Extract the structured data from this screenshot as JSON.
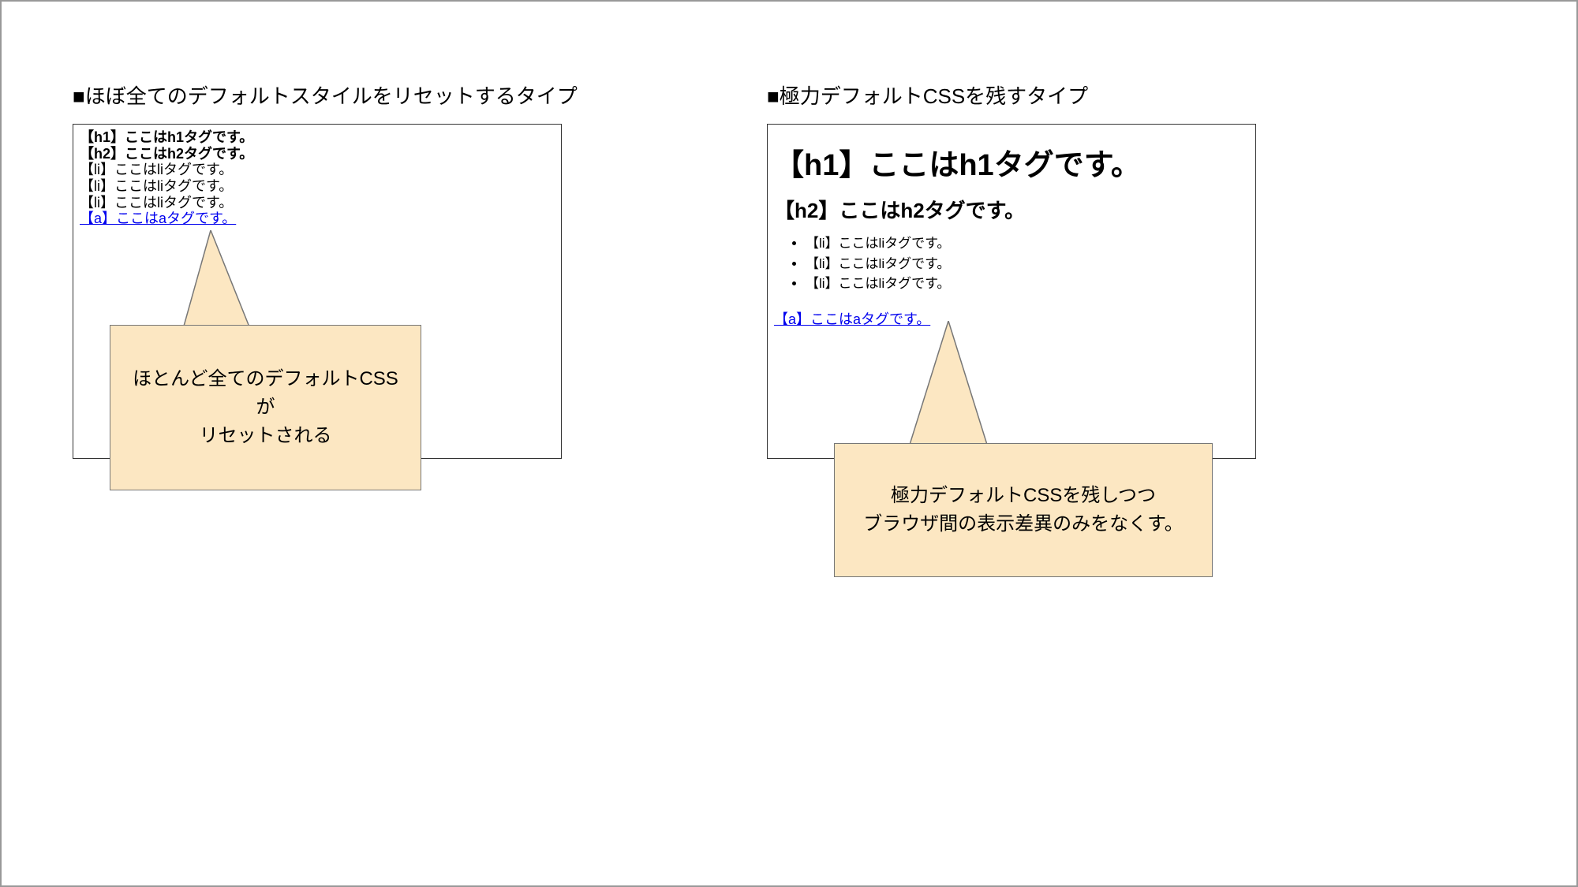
{
  "left": {
    "title": "■ほぼ全てのデフォルトスタイルをリセットするタイプ",
    "h1": "【h1】ここはh1タグです。",
    "h2": "【h2】ここはh2タグです。",
    "li1": "【li】ここはliタグです。",
    "li2": "【li】ここはliタグです。",
    "li3": "【li】ここはliタグです。",
    "a": "【a】ここはaタグです。",
    "callout_line1": "ほとんど全てのデフォルトCSSが",
    "callout_line2": "リセットされる"
  },
  "right": {
    "title": "■極力デフォルトCSSを残すタイプ",
    "h1": "【h1】ここはh1タグです。",
    "h2": "【h2】ここはh2タグです。",
    "li1": "【li】ここはliタグです。",
    "li2": "【li】ここはliタグです。",
    "li3": "【li】ここはliタグです。",
    "a": "【a】ここはaタグです。",
    "callout_line1": "極力デフォルトCSSを残しつつ",
    "callout_line2": "ブラウザ間の表示差異のみをなくす。"
  }
}
